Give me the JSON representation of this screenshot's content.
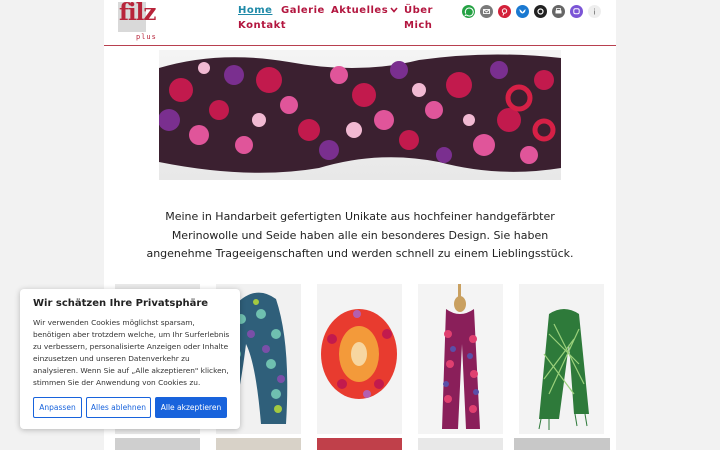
{
  "header": {
    "logo_text": "filz",
    "logo_sub": "plus",
    "nav": {
      "home": "Home",
      "galerie": "Galerie",
      "aktuelles": "Aktuelles",
      "ueber_mich": "Über Mich",
      "kontakt": "Kontakt"
    },
    "social_icons": [
      {
        "name": "whatsapp-icon",
        "color": "#25a244"
      },
      {
        "name": "email-icon",
        "color": "#7a7a7a"
      },
      {
        "name": "pinterest-icon",
        "color": "#d3213a"
      },
      {
        "name": "bluesky-icon",
        "color": "#1a79d1"
      },
      {
        "name": "threads-icon",
        "color": "#222222"
      },
      {
        "name": "print-icon",
        "color": "#666666"
      },
      {
        "name": "mastodon-icon",
        "color": "#7b55d6"
      },
      {
        "name": "info-icon",
        "color": "#dddddd"
      }
    ]
  },
  "main": {
    "intro": "Meine in Handarbeit gefertigten Unikate aus hochfeiner handgefärbter Merinowolle und Seide haben alle ein besonderes Design. Sie haben angenehme Trageeigenschaften und werden schnell zu einem Lieblingsstück."
  },
  "cookie": {
    "title": "Wir schätzen Ihre Privatsphäre",
    "text": "Wir verwenden Cookies möglichst sparsam, benötigen aber trotzdem welche, um Ihr Surferlebnis zu verbessern, personalisierte Anzeigen oder Inhalte einzusetzen und unseren Datenverkehr zu analysieren. Wenn Sie auf „Alle akzeptieren\" klicken, stimmen Sie der Anwendung von Cookies zu.",
    "customize": "Anpassen",
    "reject": "Alles ablehnen",
    "accept": "Alle akzeptieren"
  },
  "colors": {
    "brand": "#b3163f",
    "active_link": "#1f8aa8",
    "cookie_button": "#1863dc"
  }
}
